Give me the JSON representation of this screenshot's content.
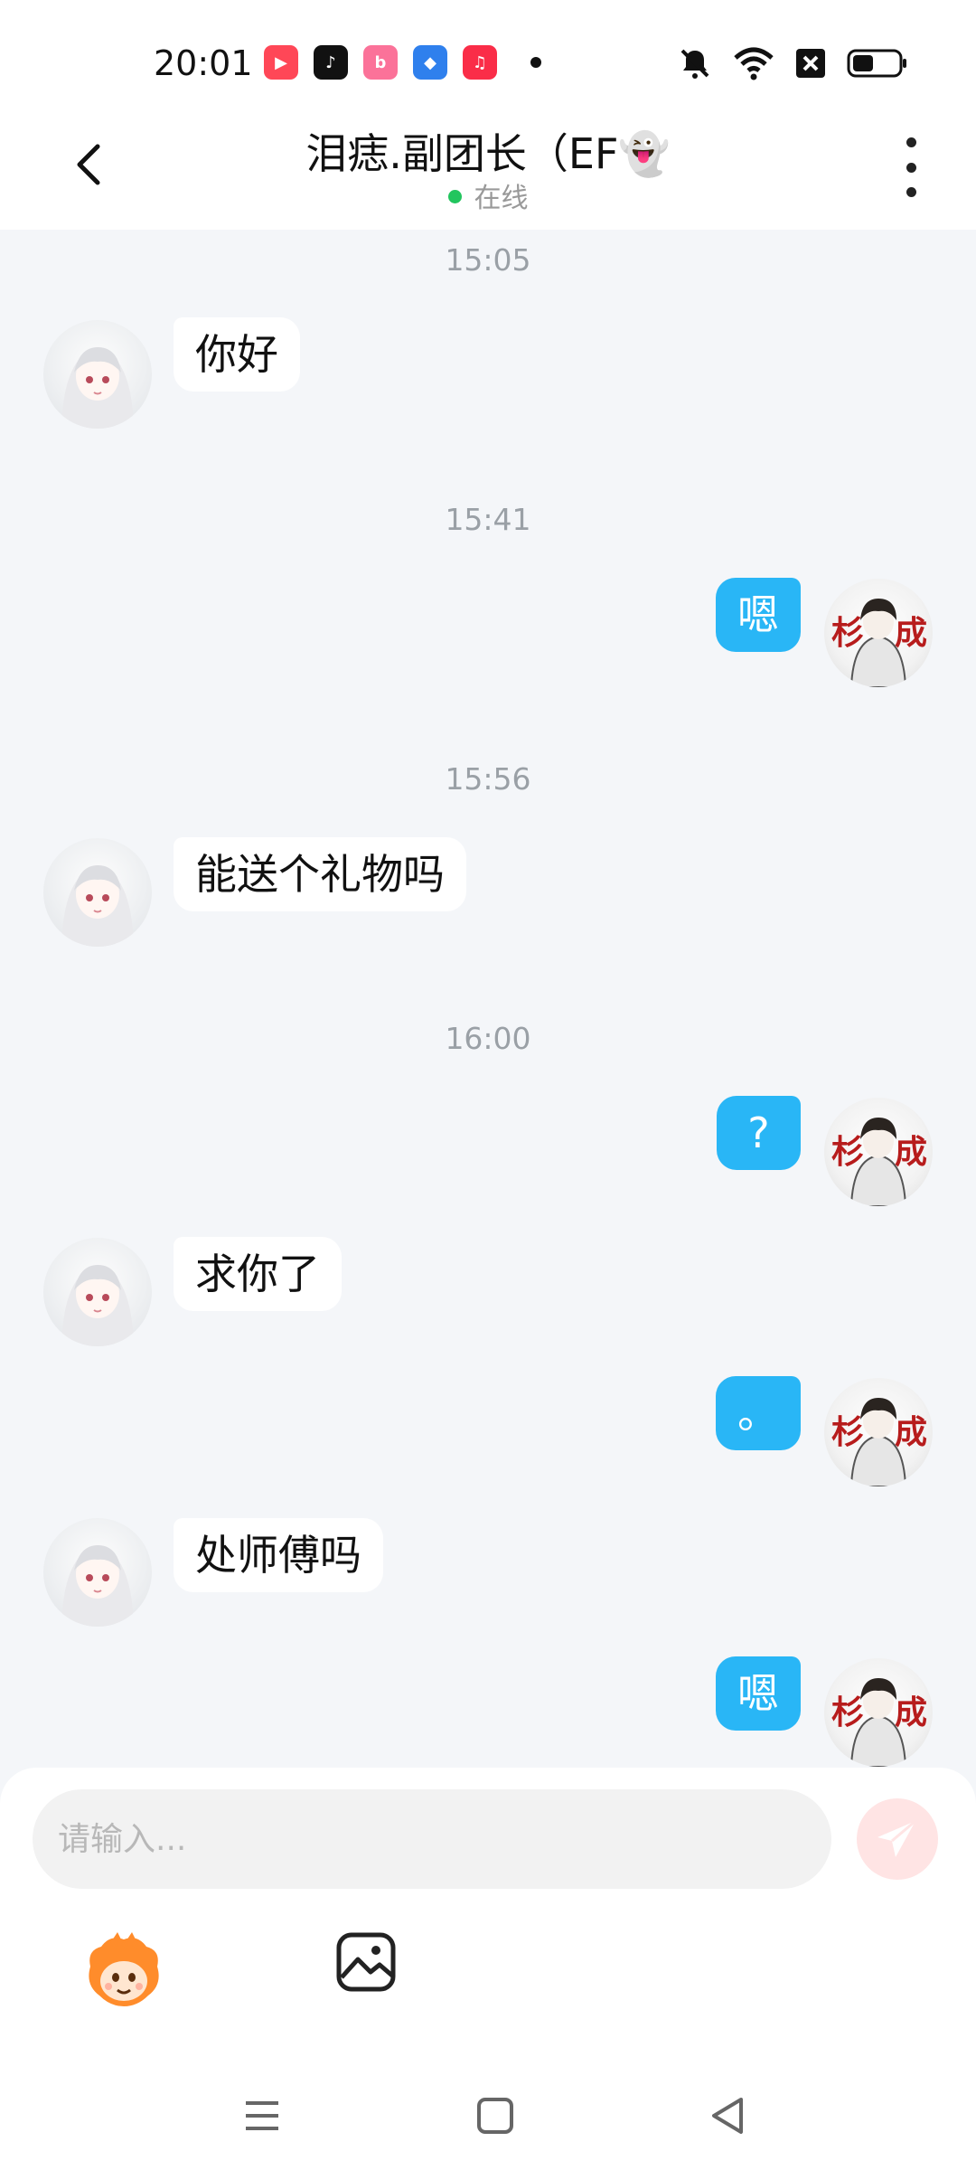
{
  "status_bar": {
    "time": "20:01",
    "apps": [
      "kuaishou-icon",
      "douyin-icon",
      "bilibili-icon",
      "app-blue-icon",
      "music-icon"
    ],
    "indicators": [
      "mute-icon",
      "wifi-icon",
      "sim-x-icon",
      "battery-icon"
    ]
  },
  "header": {
    "title": "泪痣.副团长（EF👻",
    "status": "在线",
    "status_color": "#22c55e"
  },
  "messages": [
    {
      "type": "time",
      "text": "15:05"
    },
    {
      "type": "in",
      "text": "你好"
    },
    {
      "type": "time",
      "text": "15:41"
    },
    {
      "type": "out",
      "text": "嗯"
    },
    {
      "type": "time",
      "text": "15:56"
    },
    {
      "type": "in",
      "text": "能送个礼物吗"
    },
    {
      "type": "time",
      "text": "16:00"
    },
    {
      "type": "out",
      "text": "?"
    },
    {
      "type": "in",
      "text": "求你了"
    },
    {
      "type": "out",
      "text": "。"
    },
    {
      "type": "in",
      "text": "处师傅吗"
    },
    {
      "type": "out",
      "text": "嗯"
    }
  ],
  "input": {
    "placeholder": "请输入...",
    "value": ""
  },
  "colors": {
    "accent_bubble": "#29b6f6",
    "send_button": "#ffe4e4",
    "background": "#f4f6f9"
  }
}
